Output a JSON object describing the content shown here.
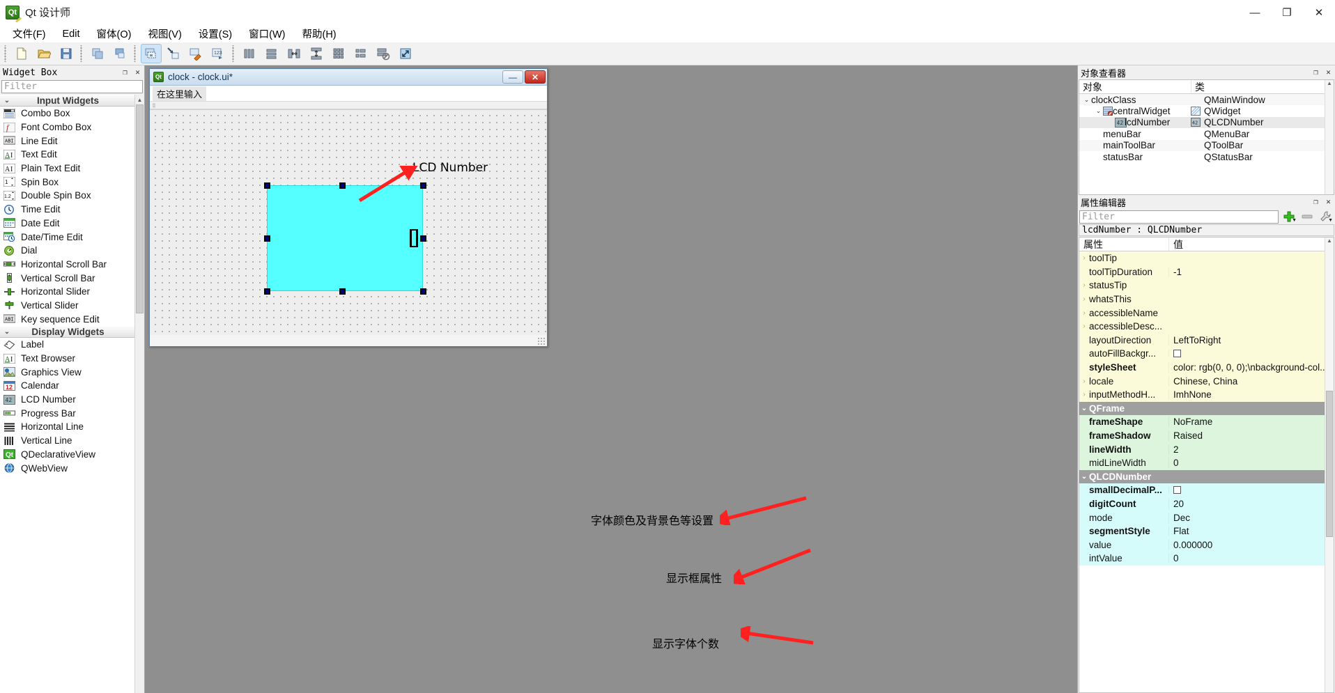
{
  "window": {
    "app_title": "Qt 设计师",
    "app_icon": "qt-logo-icon",
    "minimize_label": "—",
    "maximize_label": "❐",
    "close_label": "✕"
  },
  "menubar": {
    "items": [
      {
        "label": "文件(F)"
      },
      {
        "label": "Edit"
      },
      {
        "label": "窗体(O)"
      },
      {
        "label": "视图(V)"
      },
      {
        "label": "设置(S)"
      },
      {
        "label": "窗口(W)"
      },
      {
        "label": "帮助(H)"
      }
    ]
  },
  "toolbar": {
    "groups": [
      {
        "buttons": [
          {
            "name": "new-form-button"
          },
          {
            "name": "open-form-button"
          },
          {
            "name": "save-form-button"
          }
        ]
      },
      {
        "buttons": [
          {
            "name": "undo-button"
          },
          {
            "name": "redo-button"
          }
        ]
      },
      {
        "buttons": [
          {
            "name": "edit-widgets-button",
            "active": true
          },
          {
            "name": "edit-signals-slots-button"
          },
          {
            "name": "edit-buddies-button"
          },
          {
            "name": "edit-tab-order-button"
          }
        ]
      },
      {
        "buttons": [
          {
            "name": "layout-horizontally-button"
          },
          {
            "name": "layout-vertically-button"
          },
          {
            "name": "layout-splitter-horizontal-button"
          },
          {
            "name": "layout-splitter-vertical-button"
          },
          {
            "name": "layout-grid-button"
          },
          {
            "name": "layout-form-button"
          },
          {
            "name": "break-layout-button"
          },
          {
            "name": "adjust-size-button"
          }
        ]
      }
    ]
  },
  "widget_box": {
    "title": "Widget Box",
    "filter_placeholder": "Filter",
    "categories": [
      {
        "label": "Input Widgets",
        "expanded": true,
        "items": [
          {
            "label": "Combo Box",
            "icon": "combo-box-icon"
          },
          {
            "label": "Font Combo Box",
            "icon": "font-combo-box-icon"
          },
          {
            "label": "Line Edit",
            "icon": "line-edit-icon"
          },
          {
            "label": "Text Edit",
            "icon": "text-edit-icon"
          },
          {
            "label": "Plain Text Edit",
            "icon": "plain-text-edit-icon"
          },
          {
            "label": "Spin Box",
            "icon": "spin-box-icon"
          },
          {
            "label": "Double Spin Box",
            "icon": "double-spin-box-icon"
          },
          {
            "label": "Time Edit",
            "icon": "time-edit-icon"
          },
          {
            "label": "Date Edit",
            "icon": "date-edit-icon"
          },
          {
            "label": "Date/Time Edit",
            "icon": "date-time-edit-icon"
          },
          {
            "label": "Dial",
            "icon": "dial-icon"
          },
          {
            "label": "Horizontal Scroll Bar",
            "icon": "horizontal-scroll-bar-icon"
          },
          {
            "label": "Vertical Scroll Bar",
            "icon": "vertical-scroll-bar-icon"
          },
          {
            "label": "Horizontal Slider",
            "icon": "horizontal-slider-icon"
          },
          {
            "label": "Vertical Slider",
            "icon": "vertical-slider-icon"
          },
          {
            "label": "Key sequence Edit",
            "icon": "key-sequence-edit-icon"
          }
        ]
      },
      {
        "label": "Display Widgets",
        "expanded": true,
        "items": [
          {
            "label": "Label",
            "icon": "label-icon"
          },
          {
            "label": "Text Browser",
            "icon": "text-browser-icon"
          },
          {
            "label": "Graphics View",
            "icon": "graphics-view-icon"
          },
          {
            "label": "Calendar",
            "icon": "calendar-icon"
          },
          {
            "label": "LCD Number",
            "icon": "lcd-number-icon"
          },
          {
            "label": "Progress Bar",
            "icon": "progress-bar-icon"
          },
          {
            "label": "Horizontal Line",
            "icon": "horizontal-line-icon"
          },
          {
            "label": "Vertical Line",
            "icon": "vertical-line-icon"
          },
          {
            "label": "QDeclarativeView",
            "icon": "qdeclarativeview-icon"
          },
          {
            "label": "QWebView",
            "icon": "qwebview-icon"
          }
        ]
      }
    ]
  },
  "form_window": {
    "title": "clock - clock.ui*",
    "icon": "qt-logo-icon",
    "minimize_label": "—",
    "close_label": "✕",
    "menu_placeholder": "在这里输入",
    "lcd_value": "0"
  },
  "annotations": [
    {
      "text": "LCD Number",
      "name": "annotation-lcd-number"
    },
    {
      "text": "字体颜色及背景色等设置",
      "name": "annotation-stylesheet"
    },
    {
      "text": "显示框属性",
      "name": "annotation-frame-properties"
    },
    {
      "text": "显示字体个数",
      "name": "annotation-digit-count"
    }
  ],
  "object_inspector": {
    "title": "对象查看器",
    "columns": [
      "对象",
      "类"
    ],
    "rows": [
      {
        "name": "clockClass",
        "class": "QMainWindow",
        "indent": 0,
        "chevron": "v",
        "icon": "",
        "selected": false
      },
      {
        "name": "centralWidget",
        "class": "QWidget",
        "indent": 1,
        "chevron": "v",
        "icon": "central-widget-icon",
        "selected": false
      },
      {
        "name": "lcdNumber",
        "class": "QLCDNumber",
        "indent": 2,
        "chevron": "",
        "icon": "lcd-number-icon",
        "selected": true
      },
      {
        "name": "menuBar",
        "class": "QMenuBar",
        "indent": 1,
        "chevron": "",
        "icon": "",
        "selected": false
      },
      {
        "name": "mainToolBar",
        "class": "QToolBar",
        "indent": 1,
        "chevron": "",
        "icon": "",
        "selected": false
      },
      {
        "name": "statusBar",
        "class": "QStatusBar",
        "indent": 1,
        "chevron": "",
        "icon": "",
        "selected": false
      }
    ]
  },
  "property_editor": {
    "title": "属性编辑器",
    "filter_placeholder": "Filter",
    "object_line": "lcdNumber : QLCDNumber",
    "columns": [
      "属性",
      "值"
    ],
    "buttons": [
      {
        "name": "add-dynamic-property-button",
        "glyph": "+"
      },
      {
        "name": "remove-dynamic-property-button",
        "glyph": "—"
      },
      {
        "name": "configure-property-editor-button",
        "glyph": "wrench"
      }
    ],
    "rows": [
      {
        "prop": "toolTip",
        "value": "",
        "color": "yellow",
        "expand": true,
        "bold": false,
        "checkbox": false
      },
      {
        "prop": "toolTipDuration",
        "value": "-1",
        "color": "yellow",
        "expand": false,
        "bold": false,
        "checkbox": false
      },
      {
        "prop": "statusTip",
        "value": "",
        "color": "yellow",
        "expand": true,
        "bold": false,
        "checkbox": false
      },
      {
        "prop": "whatsThis",
        "value": "",
        "color": "yellow",
        "expand": true,
        "bold": false,
        "checkbox": false
      },
      {
        "prop": "accessibleName",
        "value": "",
        "color": "yellow",
        "expand": true,
        "bold": false,
        "checkbox": false
      },
      {
        "prop": "accessibleDesc...",
        "value": "",
        "color": "yellow",
        "expand": true,
        "bold": false,
        "checkbox": false
      },
      {
        "prop": "layoutDirection",
        "value": "LeftToRight",
        "color": "yellow",
        "expand": false,
        "bold": false,
        "checkbox": false
      },
      {
        "prop": "autoFillBackgr...",
        "value": "",
        "color": "yellow",
        "expand": false,
        "bold": false,
        "checkbox": true
      },
      {
        "prop": "styleSheet",
        "value": "color: rgb(0, 0, 0);\\nbackground-col...",
        "color": "yellow",
        "expand": false,
        "bold": true,
        "checkbox": false
      },
      {
        "prop": "locale",
        "value": "Chinese, China",
        "color": "yellow",
        "expand": true,
        "bold": false,
        "checkbox": false
      },
      {
        "prop": "inputMethodH...",
        "value": "ImhNone",
        "color": "yellow",
        "expand": true,
        "bold": false,
        "checkbox": false
      },
      {
        "prop": "QFrame",
        "value": "",
        "color": "group",
        "expand": true,
        "bold": true,
        "checkbox": false
      },
      {
        "prop": "frameShape",
        "value": "NoFrame",
        "color": "green",
        "expand": false,
        "bold": true,
        "checkbox": false
      },
      {
        "prop": "frameShadow",
        "value": "Raised",
        "color": "green",
        "expand": false,
        "bold": true,
        "checkbox": false
      },
      {
        "prop": "lineWidth",
        "value": "2",
        "color": "green",
        "expand": false,
        "bold": true,
        "checkbox": false
      },
      {
        "prop": "midLineWidth",
        "value": "0",
        "color": "green",
        "expand": false,
        "bold": false,
        "checkbox": false
      },
      {
        "prop": "QLCDNumber",
        "value": "",
        "color": "group",
        "expand": true,
        "bold": true,
        "checkbox": false
      },
      {
        "prop": "smallDecimalP...",
        "value": "",
        "color": "cyan",
        "expand": false,
        "bold": true,
        "checkbox": true
      },
      {
        "prop": "digitCount",
        "value": "20",
        "color": "cyan",
        "expand": false,
        "bold": true,
        "checkbox": false
      },
      {
        "prop": "mode",
        "value": "Dec",
        "color": "cyan",
        "expand": false,
        "bold": false,
        "checkbox": false
      },
      {
        "prop": "segmentStyle",
        "value": "Flat",
        "color": "cyan",
        "expand": false,
        "bold": true,
        "checkbox": false
      },
      {
        "prop": "value",
        "value": "0.000000",
        "color": "cyan",
        "expand": false,
        "bold": false,
        "checkbox": false
      },
      {
        "prop": "intValue",
        "value": "0",
        "color": "cyan",
        "expand": false,
        "bold": false,
        "checkbox": false
      }
    ]
  },
  "colors": {
    "lcd_background": "#55ffff",
    "annotation_arrow": "#ff2020",
    "selection_handle": "#000080",
    "desktop": "#8f8f8f"
  }
}
